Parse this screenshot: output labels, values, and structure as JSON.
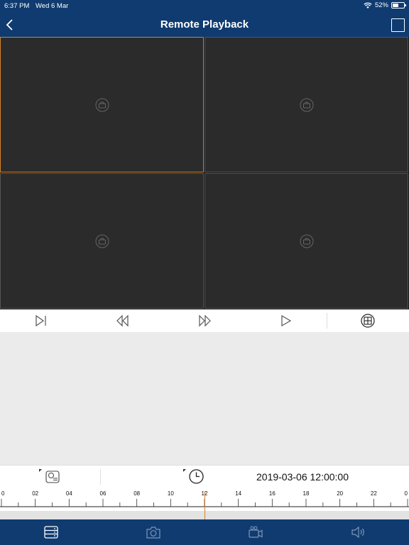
{
  "status_bar": {
    "time": "6:37 PM",
    "date": "Wed 6 Mar",
    "battery": "52%",
    "battery_level": 0.52
  },
  "nav": {
    "title": "Remote Playback",
    "back_icon": "chevron-left-icon",
    "fullscreen_icon": "fullscreen-icon"
  },
  "panes": [
    {
      "id": "pane-1",
      "selected": true,
      "icon": "camera-placeholder-icon"
    },
    {
      "id": "pane-2",
      "selected": false,
      "icon": "camera-placeholder-icon"
    },
    {
      "id": "pane-3",
      "selected": false,
      "icon": "camera-placeholder-icon"
    },
    {
      "id": "pane-4",
      "selected": false,
      "icon": "camera-placeholder-icon"
    }
  ],
  "controls": [
    "step-forward-icon",
    "rewind-icon",
    "fast-forward-icon",
    "play-icon",
    "split-screen-icon"
  ],
  "info_bar": {
    "datetime": "2019-03-06 12:00:00",
    "channel_icon": "channel-list-icon",
    "time_icon": "clock-icon"
  },
  "timeline": {
    "labels": [
      "0",
      "02",
      "04",
      "06",
      "08",
      "10",
      "12",
      "14",
      "16",
      "18",
      "20",
      "22",
      "0"
    ],
    "current_hour": 12,
    "marker_color": "#d7812a"
  },
  "tabs": [
    "device-list-icon",
    "snapshot-icon",
    "record-icon",
    "audio-icon"
  ],
  "colors": {
    "brand": "#0f3b70",
    "accent": "#d7812a",
    "pane_bg": "#2b2b2b"
  }
}
